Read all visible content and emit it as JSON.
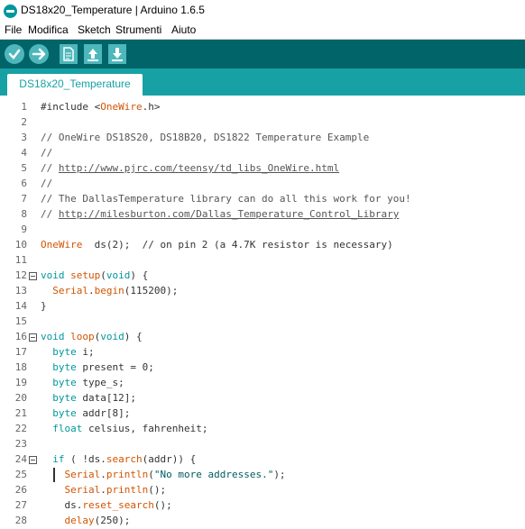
{
  "window": {
    "title": "DS18x20_Temperature | Arduino 1.6.5"
  },
  "menu": [
    "File",
    "Modifica",
    "Sketch",
    "Strumenti",
    "Aiuto"
  ],
  "toolbar": {
    "buttons": [
      {
        "name": "verify-button",
        "icon": "check-icon"
      },
      {
        "name": "upload-button",
        "icon": "arrow-right-icon"
      },
      {
        "name": "new-button",
        "icon": "new-file-icon"
      },
      {
        "name": "open-button",
        "icon": "arrow-up-icon"
      },
      {
        "name": "save-button",
        "icon": "arrow-down-icon"
      }
    ]
  },
  "tab": {
    "label": "DS18x20_Temperature"
  },
  "colors": {
    "toolbar": "#006468",
    "tabbar": "#17a1a5",
    "button": "#4db7bb",
    "keyword": "#00979c",
    "library": "#d35400"
  },
  "lines": [
    {
      "n": "1",
      "fold": false,
      "tokens": [
        [
          "plain",
          "#include <"
        ],
        [
          "lib",
          "OneWire"
        ],
        [
          "plain",
          ".h>"
        ]
      ]
    },
    {
      "n": "2",
      "fold": false,
      "tokens": []
    },
    {
      "n": "3",
      "fold": false,
      "tokens": [
        [
          "cm",
          "// OneWire DS18S20, DS18B20, DS1822 Temperature Example"
        ]
      ]
    },
    {
      "n": "4",
      "fold": false,
      "tokens": [
        [
          "cm",
          "//"
        ]
      ]
    },
    {
      "n": "5",
      "fold": false,
      "tokens": [
        [
          "cm",
          "// "
        ],
        [
          "link",
          "http://www.pjrc.com/teensy/td_libs_OneWire.html"
        ]
      ]
    },
    {
      "n": "6",
      "fold": false,
      "tokens": [
        [
          "cm",
          "//"
        ]
      ]
    },
    {
      "n": "7",
      "fold": false,
      "tokens": [
        [
          "cm",
          "// The DallasTemperature library can do all this work for you!"
        ]
      ]
    },
    {
      "n": "8",
      "fold": false,
      "tokens": [
        [
          "cm",
          "// "
        ],
        [
          "link",
          "http://milesburton.com/Dallas_Temperature_Control_Library"
        ]
      ]
    },
    {
      "n": "9",
      "fold": false,
      "tokens": []
    },
    {
      "n": "10",
      "fold": false,
      "tokens": [
        [
          "lib",
          "OneWire"
        ],
        [
          "plain",
          "  ds(2);  // on pin 2 (a 4.7K resistor is necessary)"
        ]
      ]
    },
    {
      "n": "11",
      "fold": false,
      "tokens": []
    },
    {
      "n": "12",
      "fold": true,
      "tokens": [
        [
          "kw",
          "void"
        ],
        [
          "plain",
          " "
        ],
        [
          "lib",
          "setup"
        ],
        [
          "plain",
          "("
        ],
        [
          "kw",
          "void"
        ],
        [
          "plain",
          ") {"
        ]
      ]
    },
    {
      "n": "13",
      "fold": false,
      "tokens": [
        [
          "plain",
          "  "
        ],
        [
          "lib",
          "Serial"
        ],
        [
          "plain",
          "."
        ],
        [
          "lib",
          "begin"
        ],
        [
          "plain",
          "(115200);"
        ]
      ]
    },
    {
      "n": "14",
      "fold": false,
      "tokens": [
        [
          "plain",
          "}"
        ]
      ]
    },
    {
      "n": "15",
      "fold": false,
      "tokens": []
    },
    {
      "n": "16",
      "fold": true,
      "tokens": [
        [
          "kw",
          "void"
        ],
        [
          "plain",
          " "
        ],
        [
          "lib",
          "loop"
        ],
        [
          "plain",
          "("
        ],
        [
          "kw",
          "void"
        ],
        [
          "plain",
          ") {"
        ]
      ]
    },
    {
      "n": "17",
      "fold": false,
      "tokens": [
        [
          "plain",
          "  "
        ],
        [
          "kw",
          "byte"
        ],
        [
          "plain",
          " i;"
        ]
      ]
    },
    {
      "n": "18",
      "fold": false,
      "tokens": [
        [
          "plain",
          "  "
        ],
        [
          "kw",
          "byte"
        ],
        [
          "plain",
          " present = 0;"
        ]
      ]
    },
    {
      "n": "19",
      "fold": false,
      "tokens": [
        [
          "plain",
          "  "
        ],
        [
          "kw",
          "byte"
        ],
        [
          "plain",
          " type_s;"
        ]
      ]
    },
    {
      "n": "20",
      "fold": false,
      "tokens": [
        [
          "plain",
          "  "
        ],
        [
          "kw",
          "byte"
        ],
        [
          "plain",
          " data[12];"
        ]
      ]
    },
    {
      "n": "21",
      "fold": false,
      "tokens": [
        [
          "plain",
          "  "
        ],
        [
          "kw",
          "byte"
        ],
        [
          "plain",
          " addr[8];"
        ]
      ]
    },
    {
      "n": "22",
      "fold": false,
      "tokens": [
        [
          "plain",
          "  "
        ],
        [
          "kw",
          "float"
        ],
        [
          "plain",
          " celsius, fahrenheit;"
        ]
      ]
    },
    {
      "n": "23",
      "fold": false,
      "tokens": []
    },
    {
      "n": "24",
      "fold": true,
      "tokens": [
        [
          "plain",
          "  "
        ],
        [
          "kw",
          "if"
        ],
        [
          "plain",
          " ( !ds."
        ],
        [
          "lib",
          "search"
        ],
        [
          "plain",
          "(addr)) {"
        ]
      ]
    },
    {
      "n": "25",
      "fold": false,
      "tokens": [
        [
          "plain",
          "    "
        ],
        [
          "lib",
          "Serial"
        ],
        [
          "plain",
          "."
        ],
        [
          "lib",
          "println"
        ],
        [
          "plain",
          "("
        ],
        [
          "str",
          "\"No more addresses.\""
        ],
        [
          "plain",
          ");"
        ]
      ]
    },
    {
      "n": "26",
      "fold": false,
      "tokens": [
        [
          "plain",
          "    "
        ],
        [
          "lib",
          "Serial"
        ],
        [
          "plain",
          "."
        ],
        [
          "lib",
          "println"
        ],
        [
          "plain",
          "();"
        ]
      ]
    },
    {
      "n": "27",
      "fold": false,
      "tokens": [
        [
          "plain",
          "    ds."
        ],
        [
          "lib",
          "reset_search"
        ],
        [
          "plain",
          "();"
        ]
      ]
    },
    {
      "n": "28",
      "fold": false,
      "tokens": [
        [
          "plain",
          "    "
        ],
        [
          "lib",
          "delay"
        ],
        [
          "plain",
          "(250);"
        ]
      ]
    }
  ]
}
